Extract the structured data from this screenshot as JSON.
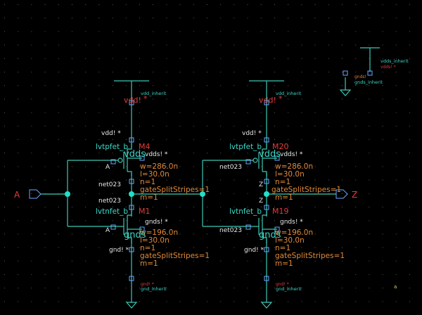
{
  "colors": {
    "background": "#000000",
    "wire": "#3cc8b4",
    "net_dot": "#22e0c8",
    "net_text": "#e8e8e8",
    "param": "#e08a3a",
    "supply": "#e83a3a",
    "pin": "#6aa8ff"
  },
  "pins": {
    "in": "A",
    "out": "Z"
  },
  "inv1": {
    "vdd_sym_label": "vdd_inherit",
    "vdd_sym_net": "vdd!",
    "pmos": {
      "supply": "vdd! *",
      "model": "lvtpfet_b",
      "inst": "M4",
      "bulk": "vdds! *",
      "gate_net": "A",
      "w": "w=286.0n",
      "l": "l=30.0n",
      "n": "n=1",
      "gss": "gateSplitStripes=1",
      "m": "m=1",
      "bulk_big": "vdds",
      "drain_net": "net023"
    },
    "nmos": {
      "drain_net": "net023",
      "model": "lvtnfet_b",
      "inst": "M1",
      "bulk": "gnds! *",
      "gate_net": "A",
      "w": "w=196.0n",
      "l": "l=30.0n",
      "n": "n=1",
      "gss": "gateSplitStripes=1",
      "m": "m=1",
      "bulk_big": "gnds",
      "supply": "gnd! *"
    },
    "gnd_sym_net": "gnd! *",
    "gnd_sym_label": "gnd_inherit"
  },
  "inv2": {
    "vdd_sym_label": "vdd_inherit",
    "vdd_sym_net": "vdd!",
    "pmos": {
      "supply": "vdd! *",
      "model": "lvtpfet_b",
      "inst": "M20",
      "bulk": "vdds! *",
      "gate_net": "net023",
      "w": "w=286.0n",
      "l": "l=30.0n",
      "n": "n=1",
      "gss": "gateSplitStripes=1",
      "m": "m=1",
      "bulk_big": "vdds",
      "drain_net": "Z"
    },
    "nmos": {
      "drain_net": "Z",
      "model": "lvtnfet_b",
      "inst": "M19",
      "bulk": "gnds! *",
      "gate_net": "net023",
      "w": "w=196.0n",
      "l": "l=30.0n",
      "n": "n=1",
      "gss": "gateSplitStripes=1",
      "m": "m=1",
      "bulk_big": "gnds",
      "supply": "gnd! *"
    },
    "gnd_sym_net": "gnd! *",
    "gnd_sym_label": "gnd_inherit"
  },
  "bulk_tie": {
    "vdds_label": "vdds_inherit",
    "vdds_net": "vdds! *",
    "gnds_net": "gnds!",
    "gnds_label": "gnds_inherit"
  },
  "corner_mark": "a"
}
